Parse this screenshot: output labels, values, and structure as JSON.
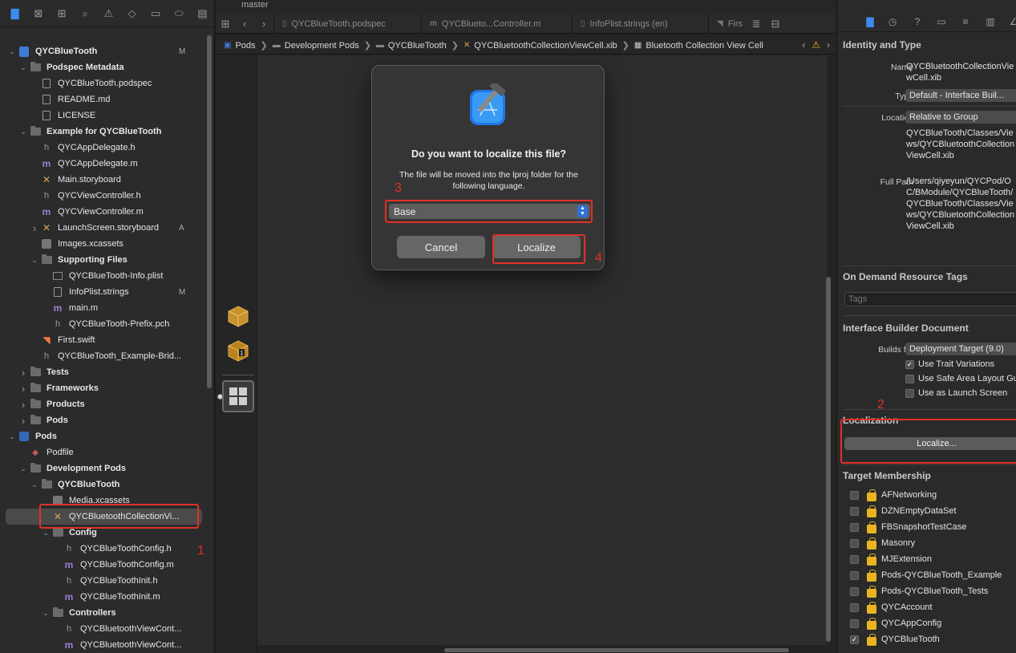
{
  "navigator": {
    "tree": [
      {
        "label": "QYCBlueTooth",
        "indent": 0,
        "chev": "v",
        "icon": "project",
        "status": "M",
        "bold": true
      },
      {
        "label": "Podspec Metadata",
        "indent": 1,
        "chev": "v",
        "icon": "folder",
        "bold": true
      },
      {
        "label": "QYCBlueTooth.podspec",
        "indent": 2,
        "icon": "file"
      },
      {
        "label": "README.md",
        "indent": 2,
        "icon": "file"
      },
      {
        "label": "LICENSE",
        "indent": 2,
        "icon": "file"
      },
      {
        "label": "Example for QYCBlueTooth",
        "indent": 1,
        "chev": "v",
        "icon": "folder",
        "bold": true
      },
      {
        "label": "QYCAppDelegate.h",
        "indent": 2,
        "icon": "h"
      },
      {
        "label": "QYCAppDelegate.m",
        "indent": 2,
        "icon": "m"
      },
      {
        "label": "Main.storyboard",
        "indent": 2,
        "icon": "xib"
      },
      {
        "label": "QYCViewController.h",
        "indent": 2,
        "icon": "h"
      },
      {
        "label": "QYCViewController.m",
        "indent": 2,
        "icon": "m"
      },
      {
        "label": "LaunchScreen.storyboard",
        "indent": 2,
        "chev": ">",
        "icon": "xib",
        "status": "A"
      },
      {
        "label": "Images.xcassets",
        "indent": 2,
        "icon": "asset"
      },
      {
        "label": "Supporting Files",
        "indent": 2,
        "chev": "v",
        "icon": "folder",
        "bold": true
      },
      {
        "label": "QYCBlueTooth-Info.plist",
        "indent": 3,
        "icon": "plist"
      },
      {
        "label": "InfoPlist.strings",
        "indent": 3,
        "icon": "file",
        "status": "M"
      },
      {
        "label": "main.m",
        "indent": 3,
        "icon": "m"
      },
      {
        "label": "QYCBlueTooth-Prefix.pch",
        "indent": 3,
        "icon": "h"
      },
      {
        "label": "First.swift",
        "indent": 2,
        "icon": "swift"
      },
      {
        "label": "QYCBlueTooth_Example-Brid...",
        "indent": 2,
        "icon": "h"
      },
      {
        "label": "Tests",
        "indent": 1,
        "chev": ">",
        "icon": "folder",
        "bold": true
      },
      {
        "label": "Frameworks",
        "indent": 1,
        "chev": ">",
        "icon": "folder",
        "bold": true
      },
      {
        "label": "Products",
        "indent": 1,
        "chev": ">",
        "icon": "folder",
        "bold": true
      },
      {
        "label": "Pods",
        "indent": 1,
        "chev": ">",
        "icon": "folder",
        "bold": true
      },
      {
        "label": "Pods",
        "indent": 0,
        "chev": "v",
        "icon": "pods",
        "bold": true
      },
      {
        "label": "Podfile",
        "indent": 1,
        "icon": "gem"
      },
      {
        "label": "Development Pods",
        "indent": 1,
        "chev": "v",
        "icon": "folder",
        "bold": true
      },
      {
        "label": "QYCBlueTooth",
        "indent": 2,
        "chev": "v",
        "icon": "folder",
        "bold": true
      },
      {
        "label": "Media.xcassets",
        "indent": 3,
        "icon": "asset"
      },
      {
        "label": "QYCBluetoothCollectionVi...",
        "indent": 3,
        "icon": "xib",
        "selected": true
      },
      {
        "label": "Config",
        "indent": 3,
        "chev": "v",
        "icon": "folder",
        "bold": true
      },
      {
        "label": "QYCBlueToothConfig.h",
        "indent": 4,
        "icon": "h"
      },
      {
        "label": "QYCBlueToothConfig.m",
        "indent": 4,
        "icon": "m"
      },
      {
        "label": "QYCBlueToothInit.h",
        "indent": 4,
        "icon": "h"
      },
      {
        "label": "QYCBlueToothInit.m",
        "indent": 4,
        "icon": "m"
      },
      {
        "label": "Controllers",
        "indent": 3,
        "chev": "v",
        "icon": "folder",
        "bold": true
      },
      {
        "label": "QYCBluetoothViewCont...",
        "indent": 4,
        "icon": "h"
      },
      {
        "label": "QYCBluetoothViewCont...",
        "indent": 4,
        "icon": "m"
      }
    ]
  },
  "editor": {
    "branch": "master",
    "tabs": [
      {
        "label": "QYCBlueTooth.podspec"
      },
      {
        "label": "QYCBlueto...Controller.m"
      },
      {
        "label": "InfoPlist.strings (en)"
      },
      {
        "label": "Firs"
      }
    ],
    "jumpbar": [
      "Pods",
      "Development Pods",
      "QYCBlueTooth",
      "QYCBluetoothCollectionViewCell.xib",
      "Bluetooth Collection View Cell"
    ]
  },
  "dialog": {
    "title": "Do you want to localize this file?",
    "message": "The file will be moved into the lproj folder for the following language.",
    "language": "Base",
    "cancel_label": "Cancel",
    "localize_label": "Localize"
  },
  "inspector": {
    "identity_title": "Identity and Type",
    "name_label": "Name",
    "name_value": "QYCBluetoothCollectionViewCell.xib",
    "type_label": "Type",
    "type_value": "Default - Interface Buil...",
    "location_label": "Location",
    "location_value": "Relative to Group",
    "location_path": "QYCBlueTooth/Classes/Views/QYCBluetoothCollectionViewCell.xib",
    "fullpath_label": "Full Path",
    "fullpath_value": "/Users/qiyeyun/QYCPod/OC/BModule/QYCBlueTooth/QYCBlueTooth/Classes/Views/QYCBluetoothCollectionViewCell.xib",
    "odr_title": "On Demand Resource Tags",
    "tags_placeholder": "Tags",
    "ib_title": "Interface Builder Document",
    "builds_for_label": "Builds for",
    "builds_for_value": "Deployment Target (9.0)",
    "checks": [
      {
        "label": "Use Trait Variations",
        "checked": true
      },
      {
        "label": "Use Safe Area Layout Gu",
        "checked": false
      },
      {
        "label": "Use as Launch Screen",
        "checked": false
      }
    ],
    "localization_title": "Localization",
    "localize_button": "Localize...",
    "target_title": "Target Membership",
    "targets": [
      {
        "label": "AFNetworking",
        "checked": false
      },
      {
        "label": "DZNEmptyDataSet",
        "checked": false
      },
      {
        "label": "FBSnapshotTestCase",
        "checked": false
      },
      {
        "label": "Masonry",
        "checked": false
      },
      {
        "label": "MJExtension",
        "checked": false
      },
      {
        "label": "Pods-QYCBlueTooth_Example",
        "checked": false
      },
      {
        "label": "Pods-QYCBlueTooth_Tests",
        "checked": false
      },
      {
        "label": "QYCAccount",
        "checked": false
      },
      {
        "label": "QYCAppConfig",
        "checked": false
      },
      {
        "label": "QYCBlueTooth",
        "checked": true
      }
    ]
  },
  "annotations": [
    "1",
    "2",
    "3",
    "4"
  ],
  "colors": {
    "annotation": "#e23028",
    "accent": "#3d8bf0",
    "lock": "#e8b420"
  }
}
